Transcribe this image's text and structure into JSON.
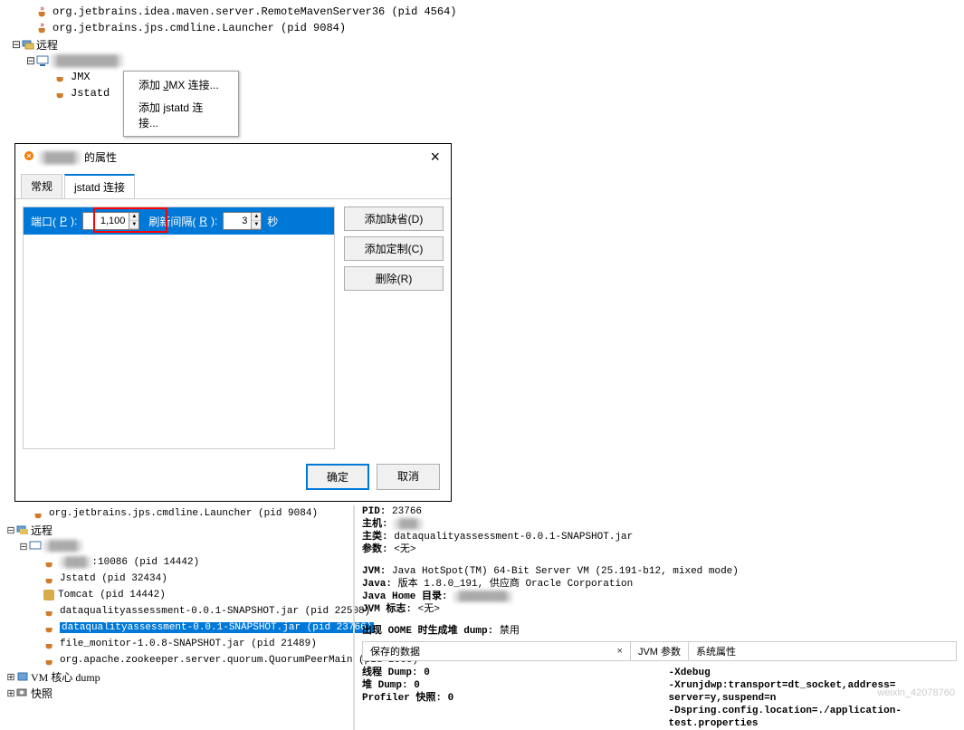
{
  "tree_top": {
    "items": [
      {
        "label": "org.jetbrains.idea.maven.server.RemoteMavenServer36 (pid 4564)",
        "indent": 28
      },
      {
        "label": "org.jetbrains.jps.cmdline.Launcher (pid 9084)",
        "indent": 28
      }
    ],
    "remote_label": "远程",
    "jmx_label": "JMX",
    "jstatd_label": "Jstatd"
  },
  "context_menu": {
    "item1_prefix": "添加 ",
    "item1_u": "J",
    "item1_suffix": "MX 连接...",
    "item2_prefix": "添加 ",
    "item2_u": "j",
    "item2_suffix": "statd 连接..."
  },
  "dialog": {
    "title_suffix": "的属性",
    "tabs": {
      "general": "常规",
      "jstatd": "jstatd 连接"
    },
    "port_label_pre": "端口(",
    "port_label_u": "P",
    "port_label_post": "):",
    "port_value": "1,100",
    "interval_label_pre": "刷新间隔(",
    "interval_label_u": "R",
    "interval_label_post": "):",
    "interval_value": "3",
    "seconds": "秒",
    "buttons": {
      "add_default": "添加缺省(D)",
      "add_custom": "添加定制(C)",
      "delete": "删除(R)",
      "ok": "确定",
      "cancel": "取消"
    }
  },
  "lower_tree": {
    "top_line": "org.jetbrains.jps.cmdline.Launcher (pid 9084)",
    "remote": "远程",
    "items": [
      ":10086 (pid 14442)",
      "Jstatd (pid 32434)",
      "Tomcat (pid 14442)",
      "dataqualityassessment-0.0.1-SNAPSHOT.jar (pid 22508)",
      "dataqualityassessment-0.0.1-SNAPSHOT.jar (pid 23766)",
      "file_monitor-1.0.8-SNAPSHOT.jar (pid 21489)",
      "org.apache.zookeeper.server.quorum.QuorumPeerMain (pid 2966)"
    ],
    "vm_dump": "VM 核心 dump",
    "snapshot": "快照"
  },
  "details": {
    "pid_label": "PID:",
    "pid_val": "23766",
    "host_label": "主机:",
    "main_class_label": "主类:",
    "main_class_val": "dataqualityassessment-0.0.1-SNAPSHOT.jar",
    "args_label": "参数:",
    "none": "<无>",
    "jvm_label": "JVM:",
    "jvm_val": "Java HotSpot(TM) 64-Bit Server VM (25.191-b12, mixed mode)",
    "java_label": "Java:",
    "java_val": "版本 1.8.0_191, 供应商 Oracle Corporation",
    "java_home_label": "Java Home 目录:",
    "jvm_flags_label": "JVM 标志:",
    "oome_label": "出现 OOME 时生成堆 dump:",
    "oome_val": "禁用",
    "tabs": {
      "saved": "保存的数据",
      "jvm_args": "JVM 参数",
      "sys_props": "系统属性"
    },
    "col1": {
      "l1": "线程 Dump: 0",
      "l2": "堆 Dump: 0",
      "l3": "Profiler 快照: 0"
    },
    "col2": {
      "l1": "-Xdebug",
      "l2": "-Xrunjdwp:transport=dt_socket,address=      server=y,suspend=n",
      "l3": "-Dspring.config.location=./application-test.properties"
    }
  },
  "watermark": "weixin_42078760"
}
